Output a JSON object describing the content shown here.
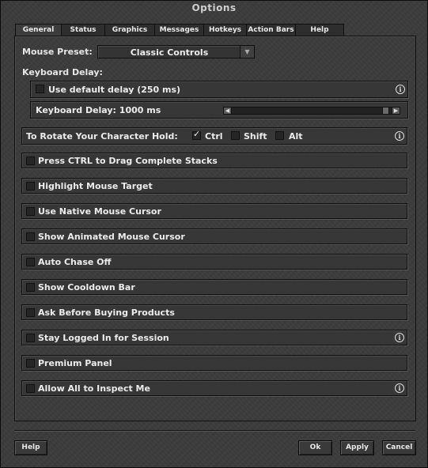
{
  "window": {
    "title": "Options"
  },
  "tabs": [
    {
      "label": "General",
      "active": true
    },
    {
      "label": "Status"
    },
    {
      "label": "Graphics"
    },
    {
      "label": "Messages"
    },
    {
      "label": "Hotkeys"
    },
    {
      "label": "Action Bars"
    },
    {
      "label": "Help"
    }
  ],
  "mouse_preset": {
    "label": "Mouse Preset:",
    "value": "Classic Controls"
  },
  "keyboard_delay": {
    "label": "Keyboard Delay:",
    "use_default_label": "Use default delay (250 ms)",
    "use_default_checked": false,
    "slider_label": "Keyboard Delay: 1000 ms",
    "slider_value_ms": 1000
  },
  "rotate": {
    "label": "To Rotate Your Character Hold:",
    "options": [
      {
        "label": "Ctrl",
        "checked": true
      },
      {
        "label": "Shift",
        "checked": false
      },
      {
        "label": "Alt",
        "checked": false
      }
    ]
  },
  "options": [
    {
      "label": "Press CTRL to Drag Complete Stacks",
      "checked": false,
      "info": false
    },
    {
      "label": "Highlight Mouse Target",
      "checked": false,
      "info": false
    },
    {
      "label": "Use Native Mouse Cursor",
      "checked": false,
      "info": false
    },
    {
      "label": "Show Animated Mouse Cursor",
      "checked": false,
      "info": false
    },
    {
      "label": "Auto Chase Off",
      "checked": false,
      "info": false
    },
    {
      "label": "Show Cooldown Bar",
      "checked": false,
      "info": false
    },
    {
      "label": "Ask Before Buying Products",
      "checked": false,
      "info": false
    },
    {
      "label": "Stay Logged In for Session",
      "checked": false,
      "info": true
    },
    {
      "label": "Premium Panel",
      "checked": false,
      "info": false
    },
    {
      "label": "Allow All to Inspect Me",
      "checked": false,
      "info": true
    }
  ],
  "info_glyph": "i",
  "buttons": {
    "help": "Help",
    "ok": "Ok",
    "apply": "Apply",
    "cancel": "Cancel"
  }
}
